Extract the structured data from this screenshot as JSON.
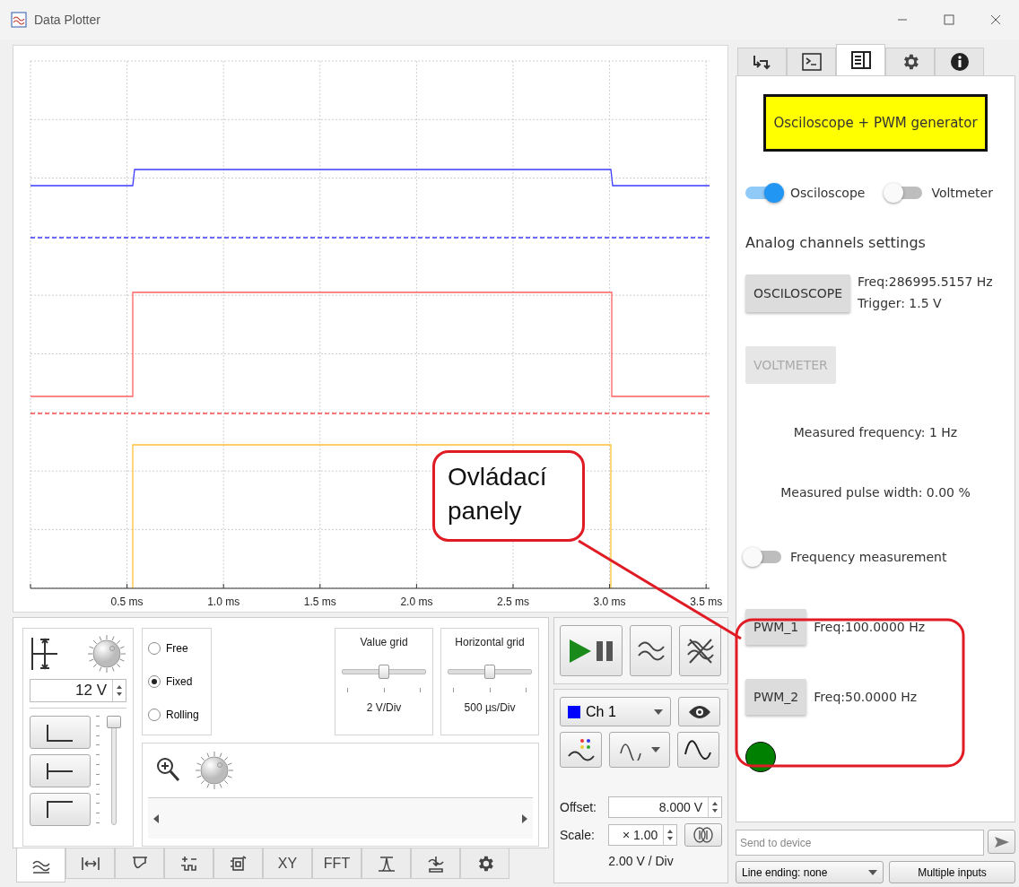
{
  "window": {
    "title": "Data Plotter"
  },
  "plot": {
    "x_tick_labels": [
      "0.5 ms",
      "1.0 ms",
      "1.5 ms",
      "2.0 ms",
      "2.5 ms",
      "3.0 ms",
      "3.5 ms"
    ]
  },
  "scale_panel": {
    "value": "12 V",
    "trigger_slider": {
      "level": 1
    }
  },
  "timing_modes": [
    {
      "label": "Free",
      "selected": false
    },
    {
      "label": "Fixed",
      "selected": true
    },
    {
      "label": "Rolling",
      "selected": false
    }
  ],
  "grids": [
    {
      "title": "Value grid",
      "level": 0.5,
      "reading": "2 V/Div"
    },
    {
      "title": "Horizontal grid",
      "level": 0.5,
      "reading": "500 µs/Div"
    }
  ],
  "bottom_tabs": [
    {
      "kind": "waves",
      "selected": true
    },
    {
      "kind": "span",
      "selected": false
    },
    {
      "kind": "trigger",
      "selected": false
    },
    {
      "kind": "cursors",
      "selected": false
    },
    {
      "kind": "device",
      "selected": false
    },
    {
      "kind": "text",
      "label": "XY",
      "selected": false
    },
    {
      "kind": "text",
      "label": "FFT",
      "selected": false
    },
    {
      "kind": "peak",
      "selected": false
    },
    {
      "kind": "math",
      "selected": false
    },
    {
      "kind": "gear",
      "selected": false
    }
  ],
  "channel_panel": {
    "channel": "Ch 1",
    "color": "#0000ff",
    "offset_label": "Offset:",
    "offset": "8.000 V",
    "scale_label": "Scale:",
    "scale": "× 1.00",
    "reading": "2.00 V / Div"
  },
  "right_tabs": [
    {
      "kind": "connect",
      "selected": false
    },
    {
      "kind": "terminal",
      "selected": false
    },
    {
      "kind": "panel",
      "selected": true
    },
    {
      "kind": "gear",
      "selected": false
    },
    {
      "kind": "info",
      "selected": false
    }
  ],
  "device_panel": {
    "title": "Osciloscope + PWM generator",
    "modes": [
      {
        "label": "Osciloscope",
        "on": true
      },
      {
        "label": "Voltmeter",
        "on": false
      }
    ],
    "section_title": "Analog channels settings",
    "osc_button": {
      "label": "OSCILOSCOPE",
      "disabled": false
    },
    "osc_info": [
      "Freq:286995.5157 Hz",
      "Trigger: 1.5 V"
    ],
    "volt_button": {
      "label": "VOLTMETER",
      "disabled": true
    },
    "measured_frequency": "Measured frequency: 1 Hz",
    "measured_pulse_width": "Measured pulse width: 0.00 %",
    "frequency_measurement": {
      "label": "Frequency measurement",
      "on": false
    },
    "pwm": [
      {
        "label": "PWM_1",
        "info": "Freq:100.0000 Hz"
      },
      {
        "label": "PWM_2",
        "info": "Freq:50.0000 Hz"
      }
    ],
    "connected": true
  },
  "terminal": {
    "placeholder": "Send to device",
    "line_ending": "Line ending: none",
    "multiple_inputs": "Multiple inputs"
  },
  "annotation": {
    "label": "Ovládací panely"
  }
}
